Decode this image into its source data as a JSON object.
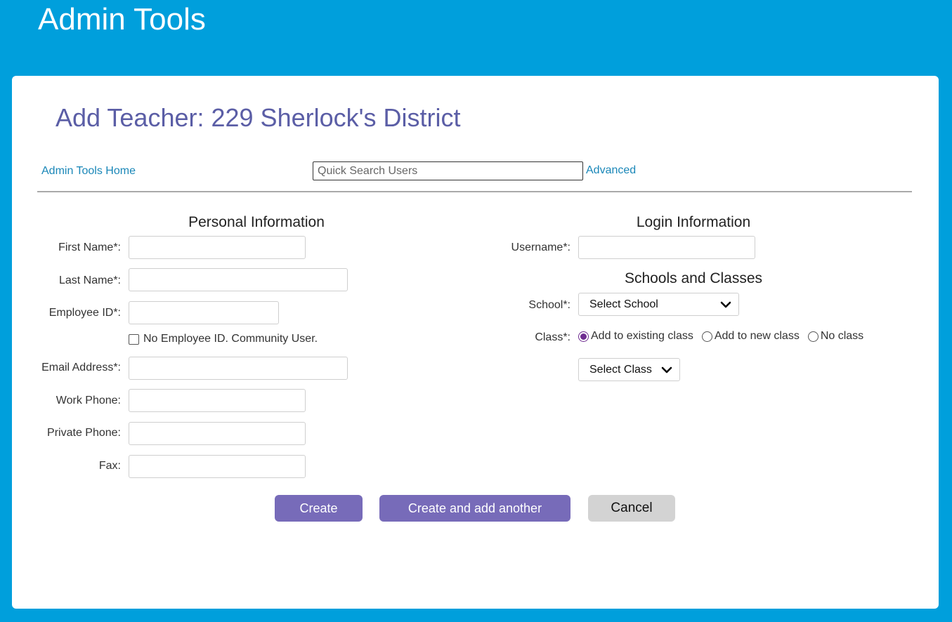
{
  "app": {
    "title": "Admin Tools"
  },
  "page": {
    "title": "Add Teacher: 229 Sherlock's District"
  },
  "nav": {
    "home_link": "Admin Tools Home",
    "search_placeholder": "Quick Search Users",
    "advanced_link": "Advanced"
  },
  "personal": {
    "section_title": "Personal Information",
    "first_name_label": "First Name*:",
    "last_name_label": "Last Name*:",
    "employee_id_label": "Employee ID*:",
    "no_employee_id_label": "No Employee ID. Community User.",
    "email_label": "Email Address*:",
    "work_phone_label": "Work Phone:",
    "private_phone_label": "Private Phone:",
    "fax_label": "Fax:"
  },
  "login": {
    "section_title": "Login Information",
    "username_label": "Username*:"
  },
  "schools": {
    "section_title": "Schools and Classes",
    "school_label": "School*:",
    "school_selected": "Select School",
    "class_label": "Class*:",
    "class_options": [
      "Add to existing class",
      "Add to new class",
      "No class"
    ],
    "class_selected_option": "Add to existing class",
    "class_select_value": "Select Class"
  },
  "buttons": {
    "create": "Create",
    "create_another": "Create and add another",
    "cancel": "Cancel"
  },
  "colors": {
    "header_bg": "#009fdc",
    "title_purple": "#5b5ea6",
    "link_blue": "#1a87b8",
    "button_purple": "#776bb9",
    "radio_purple": "#6f2c91"
  }
}
